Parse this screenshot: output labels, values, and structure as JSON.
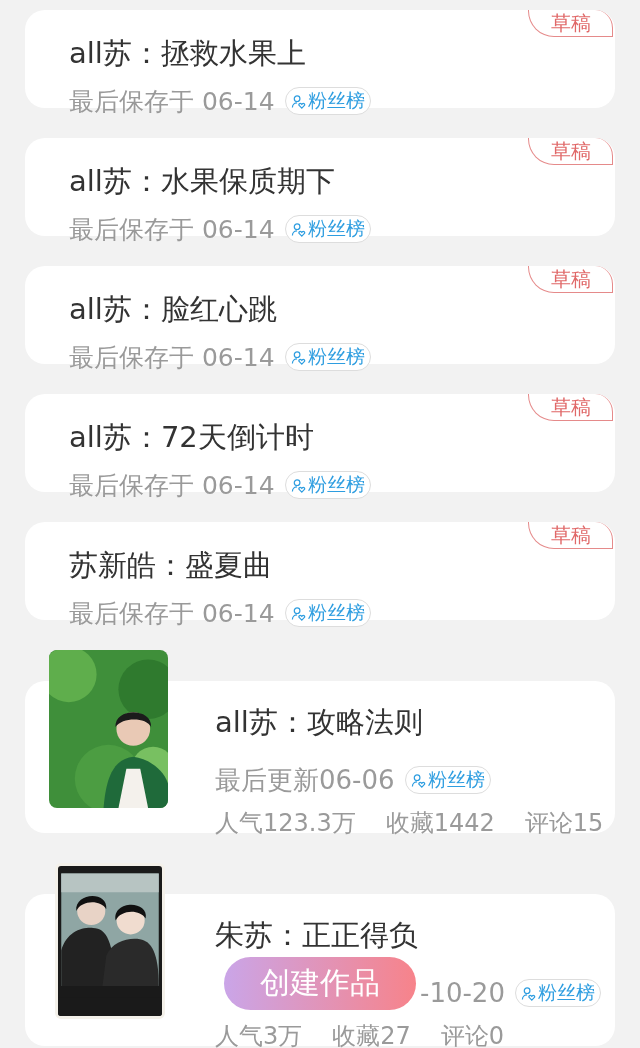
{
  "drafts": [
    {
      "title": "all苏：拯救水果上",
      "saved": "最后保存于 06-14",
      "badge": "粉丝榜",
      "tag": "草稿"
    },
    {
      "title": "all苏：水果保质期下",
      "saved": "最后保存于 06-14",
      "badge": "粉丝榜",
      "tag": "草稿"
    },
    {
      "title": "all苏：脸红心跳",
      "saved": "最后保存于 06-14",
      "badge": "粉丝榜",
      "tag": "草稿"
    },
    {
      "title": "all苏：72天倒计时",
      "saved": "最后保存于 06-14",
      "badge": "粉丝榜",
      "tag": "草稿"
    },
    {
      "title": "苏新皓：盛夏曲",
      "saved": "最后保存于 06-14",
      "badge": "粉丝榜",
      "tag": "草稿"
    }
  ],
  "works": [
    {
      "cover": {
        "kind": "picture"
      },
      "title": "all苏：攻略法则",
      "updated": [
        "最后更新06-06"
      ],
      "badge": "粉丝榜",
      "stats": [
        "人气123.3万",
        "收藏1442",
        "评论15"
      ]
    },
    {
      "cover": {
        "kind": "picture"
      },
      "title": "朱苏：正正得负",
      "updated": [
        "-10-20"
      ],
      "updated_partial": true,
      "badge": "粉丝榜",
      "stats": [
        "人气3万",
        "收藏27",
        "评论0"
      ]
    }
  ],
  "create_button": "创建作品"
}
